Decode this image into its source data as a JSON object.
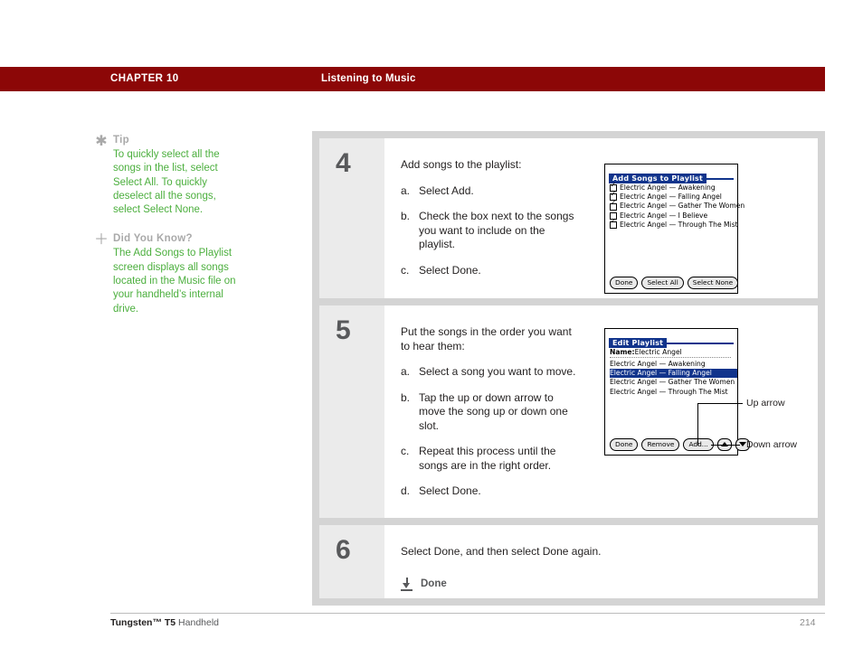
{
  "header": {
    "chapter": "CHAPTER 10",
    "section": "Listening to Music",
    "bar_color": "#8c0707"
  },
  "sidebar": {
    "tips": [
      {
        "icon": "asterisk-icon",
        "icon_glyph": "✱",
        "title": "Tip",
        "text": "To quickly select all the songs in the list, select Select All. To quickly deselect all the songs, select Select None."
      },
      {
        "icon": "plus-icon",
        "icon_glyph": "＋",
        "title": "Did You Know?",
        "text": "The Add Songs to Playlist screen displays all songs located in the Music file on your handheld’s internal drive."
      }
    ],
    "text_color": "#4caf3e",
    "title_color": "#a9a9a9"
  },
  "steps": [
    {
      "number": "4",
      "lead": "Add songs to the playlist:",
      "substeps": [
        {
          "letter": "a.",
          "text": "Select Add."
        },
        {
          "letter": "b.",
          "text": "Check the box next to the songs you want to include on the playlist."
        },
        {
          "letter": "c.",
          "text": "Select Done."
        }
      ]
    },
    {
      "number": "5",
      "lead": "Put the songs in the order you want to hear them:",
      "substeps": [
        {
          "letter": "a.",
          "text": "Select a song you want to move."
        },
        {
          "letter": "b.",
          "text": "Tap the up or down arrow to move the song up or down one slot."
        },
        {
          "letter": "c.",
          "text": "Repeat this process until the songs are in the right order."
        },
        {
          "letter": "d.",
          "text": "Select Done."
        }
      ]
    },
    {
      "number": "6",
      "lead": "Select Done, and then select Done again.",
      "substeps": [],
      "done": {
        "icon": "done-download-icon",
        "label": "Done"
      }
    }
  ],
  "screens": {
    "add_songs": {
      "title": "Add Songs to Playlist",
      "rows": [
        {
          "checked": true,
          "label": "Electric Angel — Awakening"
        },
        {
          "checked": true,
          "label": "Electric Angel — Falling Angel"
        },
        {
          "checked": true,
          "label": "Electric Angel — Gather The Women"
        },
        {
          "checked": false,
          "label": "Electric Angel — I Believe"
        },
        {
          "checked": true,
          "label": "Electric Angel — Through The Mist"
        }
      ],
      "buttons": [
        "Done",
        "Select All",
        "Select None"
      ]
    },
    "edit_playlist": {
      "title": "Edit Playlist",
      "name_label": "Name:",
      "name_value": "Electric Angel",
      "rows": [
        {
          "selected": false,
          "label": "Electric Angel — Awakening"
        },
        {
          "selected": true,
          "label": "Electric Angel — Falling Angel"
        },
        {
          "selected": false,
          "label": "Electric Angel — Gather The Women"
        },
        {
          "selected": false,
          "label": "Electric Angel — Through The Mist"
        }
      ],
      "buttons": [
        "Done",
        "Remove",
        "Add..."
      ],
      "callouts": {
        "up": "Up arrow",
        "down": "Down arrow"
      }
    }
  },
  "footer": {
    "product_bold": "Tungsten™ T5",
    "product_rest": " Handheld",
    "page": "214"
  }
}
